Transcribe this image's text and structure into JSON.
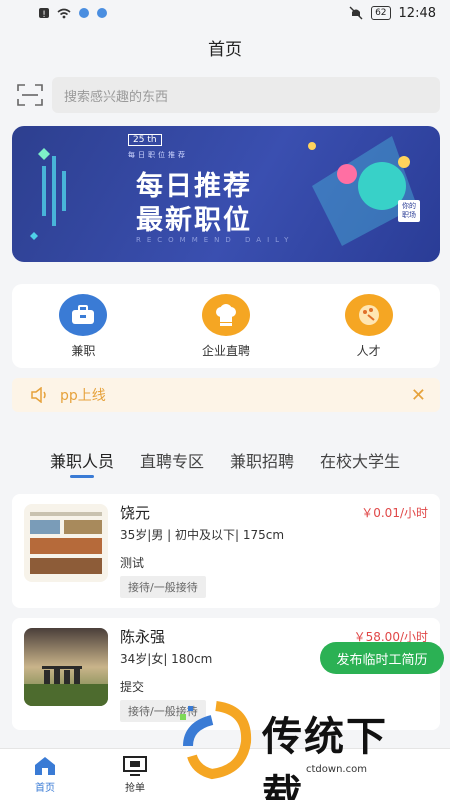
{
  "status_bar": {
    "time": "12:48",
    "battery": "62"
  },
  "header": {
    "title": "首页"
  },
  "search": {
    "placeholder": "搜索感兴趣的东西"
  },
  "banner": {
    "badge": "25 th",
    "subtitle": "每日职位推荐",
    "line1": "每日推荐",
    "line2": "最新职位",
    "english": "RECOMMEND DAILY",
    "tag": "你的职场"
  },
  "categories": [
    {
      "label": "兼职",
      "icon": "briefcase-icon",
      "color": "#3a7bd5"
    },
    {
      "label": "企业直聘",
      "icon": "chef-hat-icon",
      "color": "#f5a623"
    },
    {
      "label": "人才",
      "icon": "palette-icon",
      "color": "#f5a623"
    }
  ],
  "notice": {
    "text": "pp上线"
  },
  "tabs": [
    {
      "label": "兼职人员",
      "active": true
    },
    {
      "label": "直聘专区",
      "active": false
    },
    {
      "label": "兼职招聘",
      "active": false
    },
    {
      "label": "在校大学生",
      "active": false
    }
  ],
  "workers": [
    {
      "name": "饶元",
      "salary": "￥0.01/小时",
      "info": "35岁|男 | 初中及以下| 175cm",
      "desc": "测试",
      "tag": "接待/一般接待"
    },
    {
      "name": "陈永强",
      "salary": "￥58.00/小时",
      "info": "34岁|女| 180cm",
      "desc": "提交",
      "tag": "接待/一般接待"
    }
  ],
  "fab": {
    "label": "发布临时工简历"
  },
  "bottom_nav": [
    {
      "label": "首页",
      "icon": "home-icon",
      "active": true
    },
    {
      "label": "抢单",
      "icon": "monitor-icon",
      "active": false
    }
  ],
  "watermark": {
    "text": "传统下载",
    "url": "ctdown.com"
  },
  "colors": {
    "primary": "#3a7bd5",
    "accent": "#f5a623",
    "salary": "#e04848",
    "fab": "#2bb154",
    "notice": "#e6a23c"
  }
}
